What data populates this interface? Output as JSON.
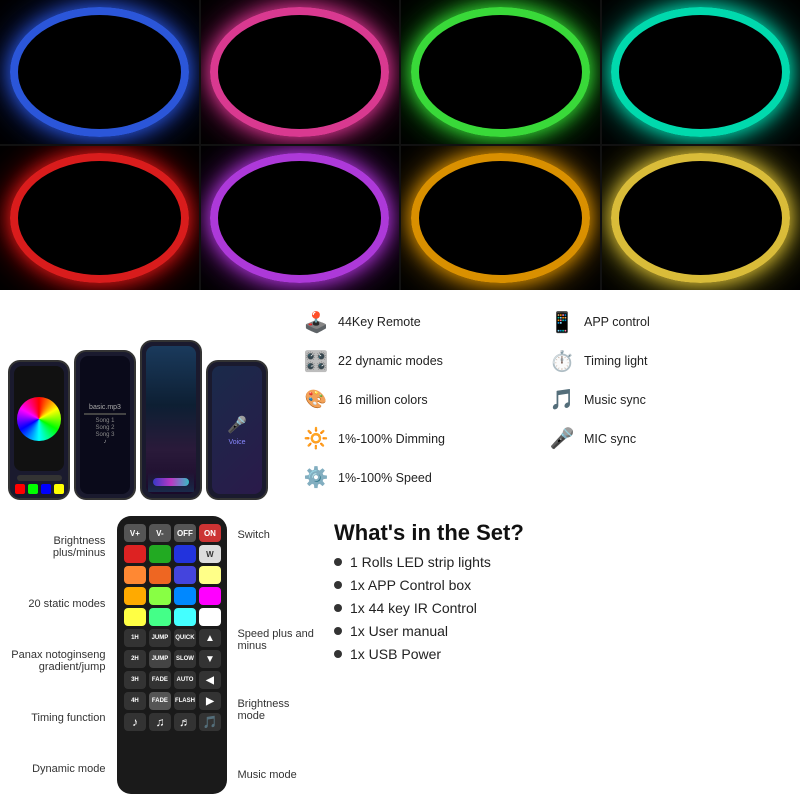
{
  "photo_grid": {
    "cells": [
      {
        "color": "#3366ff",
        "glow": "#2244cc",
        "label": "blue-led"
      },
      {
        "color": "#ff44aa",
        "glow": "#cc2288",
        "label": "pink-led"
      },
      {
        "color": "#44ff44",
        "glow": "#22cc22",
        "label": "green-led"
      },
      {
        "color": "#00ffcc",
        "glow": "#00ccaa",
        "label": "cyan-led"
      },
      {
        "color": "#ff2222",
        "glow": "#cc0000",
        "label": "red-led"
      },
      {
        "color": "#cc44ff",
        "glow": "#aa22cc",
        "label": "purple-led"
      },
      {
        "color": "#ffaa00",
        "glow": "#cc8800",
        "label": "amber-led"
      },
      {
        "color": "#ffdd44",
        "glow": "#ccbb22",
        "label": "warm-led"
      }
    ]
  },
  "features": [
    {
      "icon": "🕹️",
      "text": "44Key Remote",
      "side": "left"
    },
    {
      "icon": "📱",
      "text": "APP control",
      "side": "right"
    },
    {
      "icon": "🎛️",
      "text": "22 dynamic modes",
      "side": "left"
    },
    {
      "icon": "⏱️",
      "text": "Timing light",
      "side": "right"
    },
    {
      "icon": "🎨",
      "text": "16 million colors",
      "side": "left"
    },
    {
      "icon": "🎵",
      "text": "Music sync",
      "side": "right"
    },
    {
      "icon": "🔆",
      "text": "1%-100% Dimming",
      "side": "left"
    },
    {
      "icon": "🎤",
      "text": "MIC sync",
      "side": "right"
    },
    {
      "icon": "⚡",
      "text": "1%-100% Speed",
      "side": "wide"
    }
  ],
  "remote": {
    "labels_left": [
      "Brightness plus/minus",
      "20 static modes",
      "Panax notoginseng gradient/jump",
      "Timing function",
      "Dynamic mode"
    ],
    "labels_right": [
      "Switch",
      "Speed plus and minus",
      "Brightness mode",
      "Music mode"
    ],
    "rows": [
      [
        {
          "label": "V+",
          "bg": "#555"
        },
        {
          "label": "V-",
          "bg": "#555"
        },
        {
          "label": "OFF",
          "bg": "#555"
        },
        {
          "label": "ON",
          "bg": "#e44"
        }
      ],
      [
        {
          "label": "",
          "bg": "#e22"
        },
        {
          "label": "",
          "bg": "#2a2"
        },
        {
          "label": "",
          "bg": "#33f"
        },
        {
          "label": "W",
          "bg": "#ddd",
          "dark": true
        }
      ],
      [
        {
          "label": "",
          "bg": "#f84"
        },
        {
          "label": "",
          "bg": "#e62"
        },
        {
          "label": "",
          "bg": "#44d"
        },
        {
          "label": "",
          "bg": "#ffa"
        }
      ],
      [
        {
          "label": "",
          "bg": "#fa0"
        },
        {
          "label": "",
          "bg": "#8f4"
        },
        {
          "label": "",
          "bg": "#08f"
        },
        {
          "label": "",
          "bg": "#f0f"
        }
      ],
      [
        {
          "label": "",
          "bg": "#ff4"
        },
        {
          "label": "",
          "bg": "#4f8"
        },
        {
          "label": "",
          "bg": "#4ff"
        },
        {
          "label": "",
          "bg": "#fff",
          "dark": true
        }
      ],
      [
        {
          "label": "1H",
          "bg": "#333"
        },
        {
          "label": "JUMP",
          "bg": "#333"
        },
        {
          "label": "QUICK",
          "bg": "#333"
        },
        {
          "label": "",
          "bg": "#333"
        }
      ],
      [
        {
          "label": "2H",
          "bg": "#333"
        },
        {
          "label": "JUMP",
          "bg": "#444"
        },
        {
          "label": "SLOW",
          "bg": "#333"
        },
        {
          "label": "",
          "bg": "#333"
        }
      ],
      [
        {
          "label": "3H",
          "bg": "#333"
        },
        {
          "label": "FADE",
          "bg": "#333"
        },
        {
          "label": "AUTO",
          "bg": "#333"
        },
        {
          "label": "",
          "bg": "#333"
        }
      ],
      [
        {
          "label": "4H",
          "bg": "#333"
        },
        {
          "label": "FADE",
          "bg": "#555"
        },
        {
          "label": "FLASH",
          "bg": "#333"
        },
        {
          "label": "",
          "bg": "#333"
        }
      ],
      [
        {
          "label": "🎵",
          "bg": "#333"
        },
        {
          "label": "🎵",
          "bg": "#333"
        },
        {
          "label": "🎵",
          "bg": "#333"
        },
        {
          "label": "🎵",
          "bg": "#333"
        }
      ]
    ]
  },
  "whats_in_set": {
    "title": "What's in the Set?",
    "items": [
      "1 Rolls LED strip lights",
      "1x APP Control box",
      "1x 44 key IR Control",
      "1x User manual",
      "1x USB Power"
    ]
  }
}
